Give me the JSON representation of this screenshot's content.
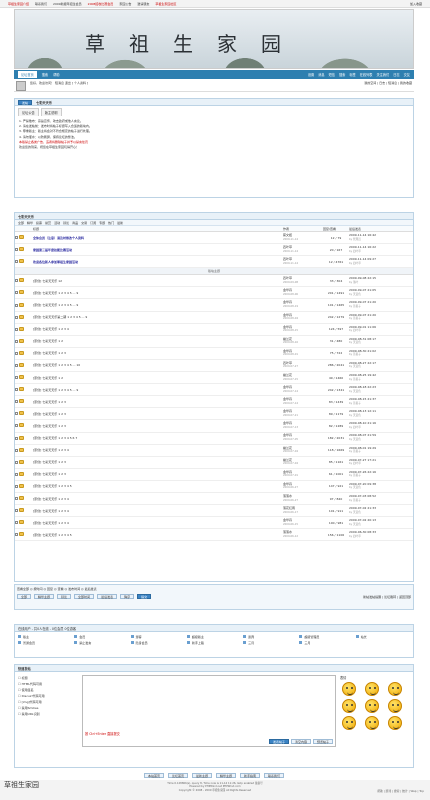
{
  "topbar": {
    "links": [
      "草祖生家园介绍",
      "联系我们",
      "2009新报年招生会员",
      "2008招收比赛会员",
      "家园公告",
      "邀请朋友",
      "草祖生家园社区"
    ],
    "right": "加入收藏"
  },
  "banner": {
    "title": "草祖生家园"
  },
  "nav": {
    "tab": "论坛首页",
    "items": [
      "搜索",
      "帮助"
    ],
    "right_items": [
      "设置",
      "消息",
      "短信",
      "搜索",
      "标签",
      "在线列表",
      "关注我们",
      "日志",
      "交友"
    ]
  },
  "userbar": {
    "text": "您好，欢迎访问！  短消息  退出  [ 个人资料 ]",
    "right": "我的空间 | 日志 | 短消息 | 我的收藏"
  },
  "notice": {
    "tabs": [
      "论坛公告",
      "版主说明"
    ],
    "lines": [
      "1. 严禁散布：宗旨宣传、攻击政府或他人言论。",
      "2. 请在发帖前：发布时将帖子标题写入合适的版块内。",
      "3. 尊重版主：版主将会对不符合规定的帖子进行处理。",
      "4. 请勿灌水：以防刷屏，保持论坛的整洁。"
    ],
    "red_line": "本版禁止各类广告，违者将删除帖子并予以禁言处罚",
    "footer": "欢迎您的到来，祝您在草祖生家园玩得开心！"
  },
  "forum": {
    "board_title": "七彩天天乐",
    "tabs": [
      "全部",
      "精华",
      "投票",
      "悬赏",
      "活动",
      "辩论",
      "商品",
      "交易",
      "订阅",
      "专题",
      "热门",
      "最新"
    ],
    "columns": [
      "标题",
      "作者",
      "回复/查看",
      "最后发表"
    ],
    "sticky_rows": [
      {
        "title": "全体会员（注意）请及时修改个人资料",
        "author": "蔡文姬",
        "date": "2009-11-14",
        "count": "12 / 79",
        "last": "2009-11-14 16:42",
        "last_by": "by 管理员"
      },
      {
        "title": "家园第三届年度技能比赛活动",
        "author": "四叶草",
        "date": "2009-11-14",
        "count": "20 / 167",
        "last": "2009-11-14 16:22",
        "last_by": "by 四叶草"
      },
      {
        "title": "欢迎各位新人参加草祖生家园活动",
        "author": "四叶草",
        "date": "2009-11-14",
        "count": "12 / 4761",
        "last": "2009-11-14 09:27",
        "last_by": "by 四叶草"
      }
    ],
    "separator": "版块主题",
    "rows": [
      {
        "title": "[原创] 七彩天天乐 12",
        "author": "四叶草",
        "date": "2009-09-08",
        "count": "33 / 304",
        "last": "2009-09-08 22:15",
        "last_by": "by 落叶"
      },
      {
        "title": "[原创] 七彩天天乐 1 2 3 4 5 ... 9",
        "author": "金华丹",
        "date": "2009-08-06",
        "count": "201 / 1491",
        "last": "2009-09-07 21:05",
        "last_by": "by 天蓝色"
      },
      {
        "title": "[原创] 七彩天天乐 1 2 3 4 5 ... 9",
        "author": "金华丹",
        "date": "2009-08-19",
        "count": "101 / 1465",
        "last": "2009-09-07 21:20",
        "last_by": "by 菩提子"
      },
      {
        "title": "[原创] 七彩天天乐第二期 1 2 3 4 5 ... 9",
        "author": "金华丹",
        "date": "2009-08-04",
        "count": "242 / 1279",
        "last": "2009-09-07 21:20",
        "last_by": "by 菩提子"
      },
      {
        "title": "[原创] 七彩天天乐 1 2 3 4",
        "author": "金华丹",
        "date": "2009-08-15",
        "count": "124 / 597",
        "last": "2009-09-01 11:06",
        "last_by": "by 四叶草"
      },
      {
        "title": "[原创] 七彩天天乐 1 2",
        "author": "幽兰花",
        "date": "2009-08-16",
        "count": "31 / 480",
        "last": "2009-08-31 08:17",
        "last_by": "by 天蓝色"
      },
      {
        "title": "[原创] 七彩天天乐 1 2 3",
        "author": "金华丹",
        "date": "2009-08-01",
        "count": "75 / 722",
        "last": "2009-08-30 21:02",
        "last_by": "by 菩提子"
      },
      {
        "title": "[原创] 七彩天天乐 1 2 3 4 5 ... 10",
        "author": "四叶草",
        "date": "2009-07-27",
        "count": "286 / 2041",
        "last": "2009-08-27 22:17",
        "last_by": "by 天蓝色"
      },
      {
        "title": "[原创] 七彩天天乐 1 2",
        "author": "幽兰花",
        "date": "2009-07-15",
        "count": "49 / 1460",
        "last": "2009-08-25 19:42",
        "last_by": "by 菩提子"
      },
      {
        "title": "[原创] 七彩天天乐 1 2 3 4 5 ... 9",
        "author": "金华丹",
        "date": "2009-07-14",
        "count": "242 / 1341",
        "last": "2009-08-18 22:23",
        "last_by": "by 天蓝色"
      },
      {
        "title": "[原创] 七彩天天乐 1 2 3",
        "author": "金华丹",
        "date": "2009-07-14",
        "count": "83 / 1439",
        "last": "2009-08-15 21:37",
        "last_by": "by 菩提子"
      },
      {
        "title": "[原创] 七彩天天乐 1 2 3",
        "author": "金华丹",
        "date": "2009-07-21",
        "count": "89 / 1179",
        "last": "2009-08-13 12:11",
        "last_by": "by 天蓝色"
      },
      {
        "title": "[原创] 七彩天天乐 1 2 3",
        "author": "金华丹",
        "date": "2009-07-13",
        "count": "82 / 1289",
        "last": "2009-08-10 21:16",
        "last_by": "by 四叶草"
      },
      {
        "title": "[原创] 七彩天天乐 1 2 3 4 5 6 7",
        "author": "金华丹",
        "date": "2009-07-05",
        "count": "182 / 2031",
        "last": "2009-08-07 21:59",
        "last_by": "by 天蓝色"
      },
      {
        "title": "[原创] 七彩天天乐 1 2 3 4",
        "author": "幽兰花",
        "date": "2009-07-04",
        "count": "118 / 1669",
        "last": "2009-08-01 19:29",
        "last_by": "by 菩提子"
      },
      {
        "title": "[原创] 七彩天天乐 1 2 3",
        "author": "幽兰花",
        "date": "2009-07-04",
        "count": "85 / 1161",
        "last": "2009-07-27 17:21",
        "last_by": "by 四叶草"
      },
      {
        "title": "[原创] 七彩天天乐 1 2 3",
        "author": "金华丹",
        "date": "2009-07-01",
        "count": "61 / 1001",
        "last": "2009-07-26 22:16",
        "last_by": "by 菩提子"
      },
      {
        "title": "[原创] 七彩天天乐 1 2 3 4 5",
        "author": "金华丹",
        "date": "2009-06-27",
        "count": "147 / 921",
        "last": "2009-07-20 09:38",
        "last_by": "by 天蓝色"
      },
      {
        "title": "[原创] 七彩天天乐 1 2 3 4",
        "author": "落落水",
        "date": "2009-06-27",
        "count": "97 / 840",
        "last": "2009-07-03 08:52",
        "last_by": "by 菩提子"
      },
      {
        "title": "[原创] 七彩天天乐 1 2 3 4",
        "author": "落花红雨",
        "date": "2009-06-17",
        "count": "101 / 911",
        "last": "2009-07-02 21:33",
        "last_by": "by 天蓝色"
      },
      {
        "title": "[原创] 七彩天天乐 1 2 3 4",
        "author": "金华丹",
        "date": "2009-06-15",
        "count": "100 / 981",
        "last": "2009-07-02 20:13",
        "last_by": "by 天蓝色"
      },
      {
        "title": "[原创] 七彩天天乐 1 2 3 4 5",
        "author": "落落水",
        "date": "2009-06-12",
        "count": "156 / 1106",
        "last": "2009-06-30 08:33",
        "last_by": "by 四叶草"
      }
    ]
  },
  "paging": {
    "filter_label": "查看全部  ◎ 按时间  ◎ 回复  ◎ 查看  ◎ 发布时间  ◎ 最后发表",
    "buttons": [
      "全部",
      "精华主题",
      "辩论"
    ],
    "select1": "全部时间",
    "select2": "最后发表",
    "select3": "降序",
    "go": "提交",
    "right": "新帖发帖提醒  |  论坛跳转  |  返回顶部"
  },
  "online": {
    "title": "在线用户 - 共0人在线 - 0位会员 0位游客",
    "items": [
      "版主",
      "会员",
      "游客",
      "超级版主",
      "贵宾",
      "超级管理员",
      "站长",
      "普通会员",
      "禁止发言",
      "隐身会员",
      "新手上路",
      "三月",
      "三月"
    ]
  },
  "post": {
    "title": "快速发帖",
    "opts": [
      "标题",
      "HTML代码可用",
      "使用签名",
      "Discuz!代码可用",
      "[img]代码可用",
      "禁用Smilies",
      "禁用URL识别"
    ],
    "hint": "按 Ctrl+Enter 直接提交",
    "buttons": [
      "发表帖子",
      "清空内容",
      "预览帖子"
    ],
    "smiles_label": "表情"
  },
  "bottom_nav": [
    "本站首页",
    "论坛首页",
    "最新主题",
    "精华主题",
    "新手指南",
    "联系我们"
  ],
  "footer": {
    "l1": "Time 0.128806(s), query 8, Time now is 11-14 11:26, Gzip enabled 备案号",
    "l2": "Powered by PHPWind.net PHPWind.com",
    "l3": "Copyright © 2008 - 2009 草祖生家园 All Rights Reserved",
    "left": "草祖生家园",
    "right": "帮助 | 游戏 | 搜索 | 统计 | Wap | Top"
  }
}
